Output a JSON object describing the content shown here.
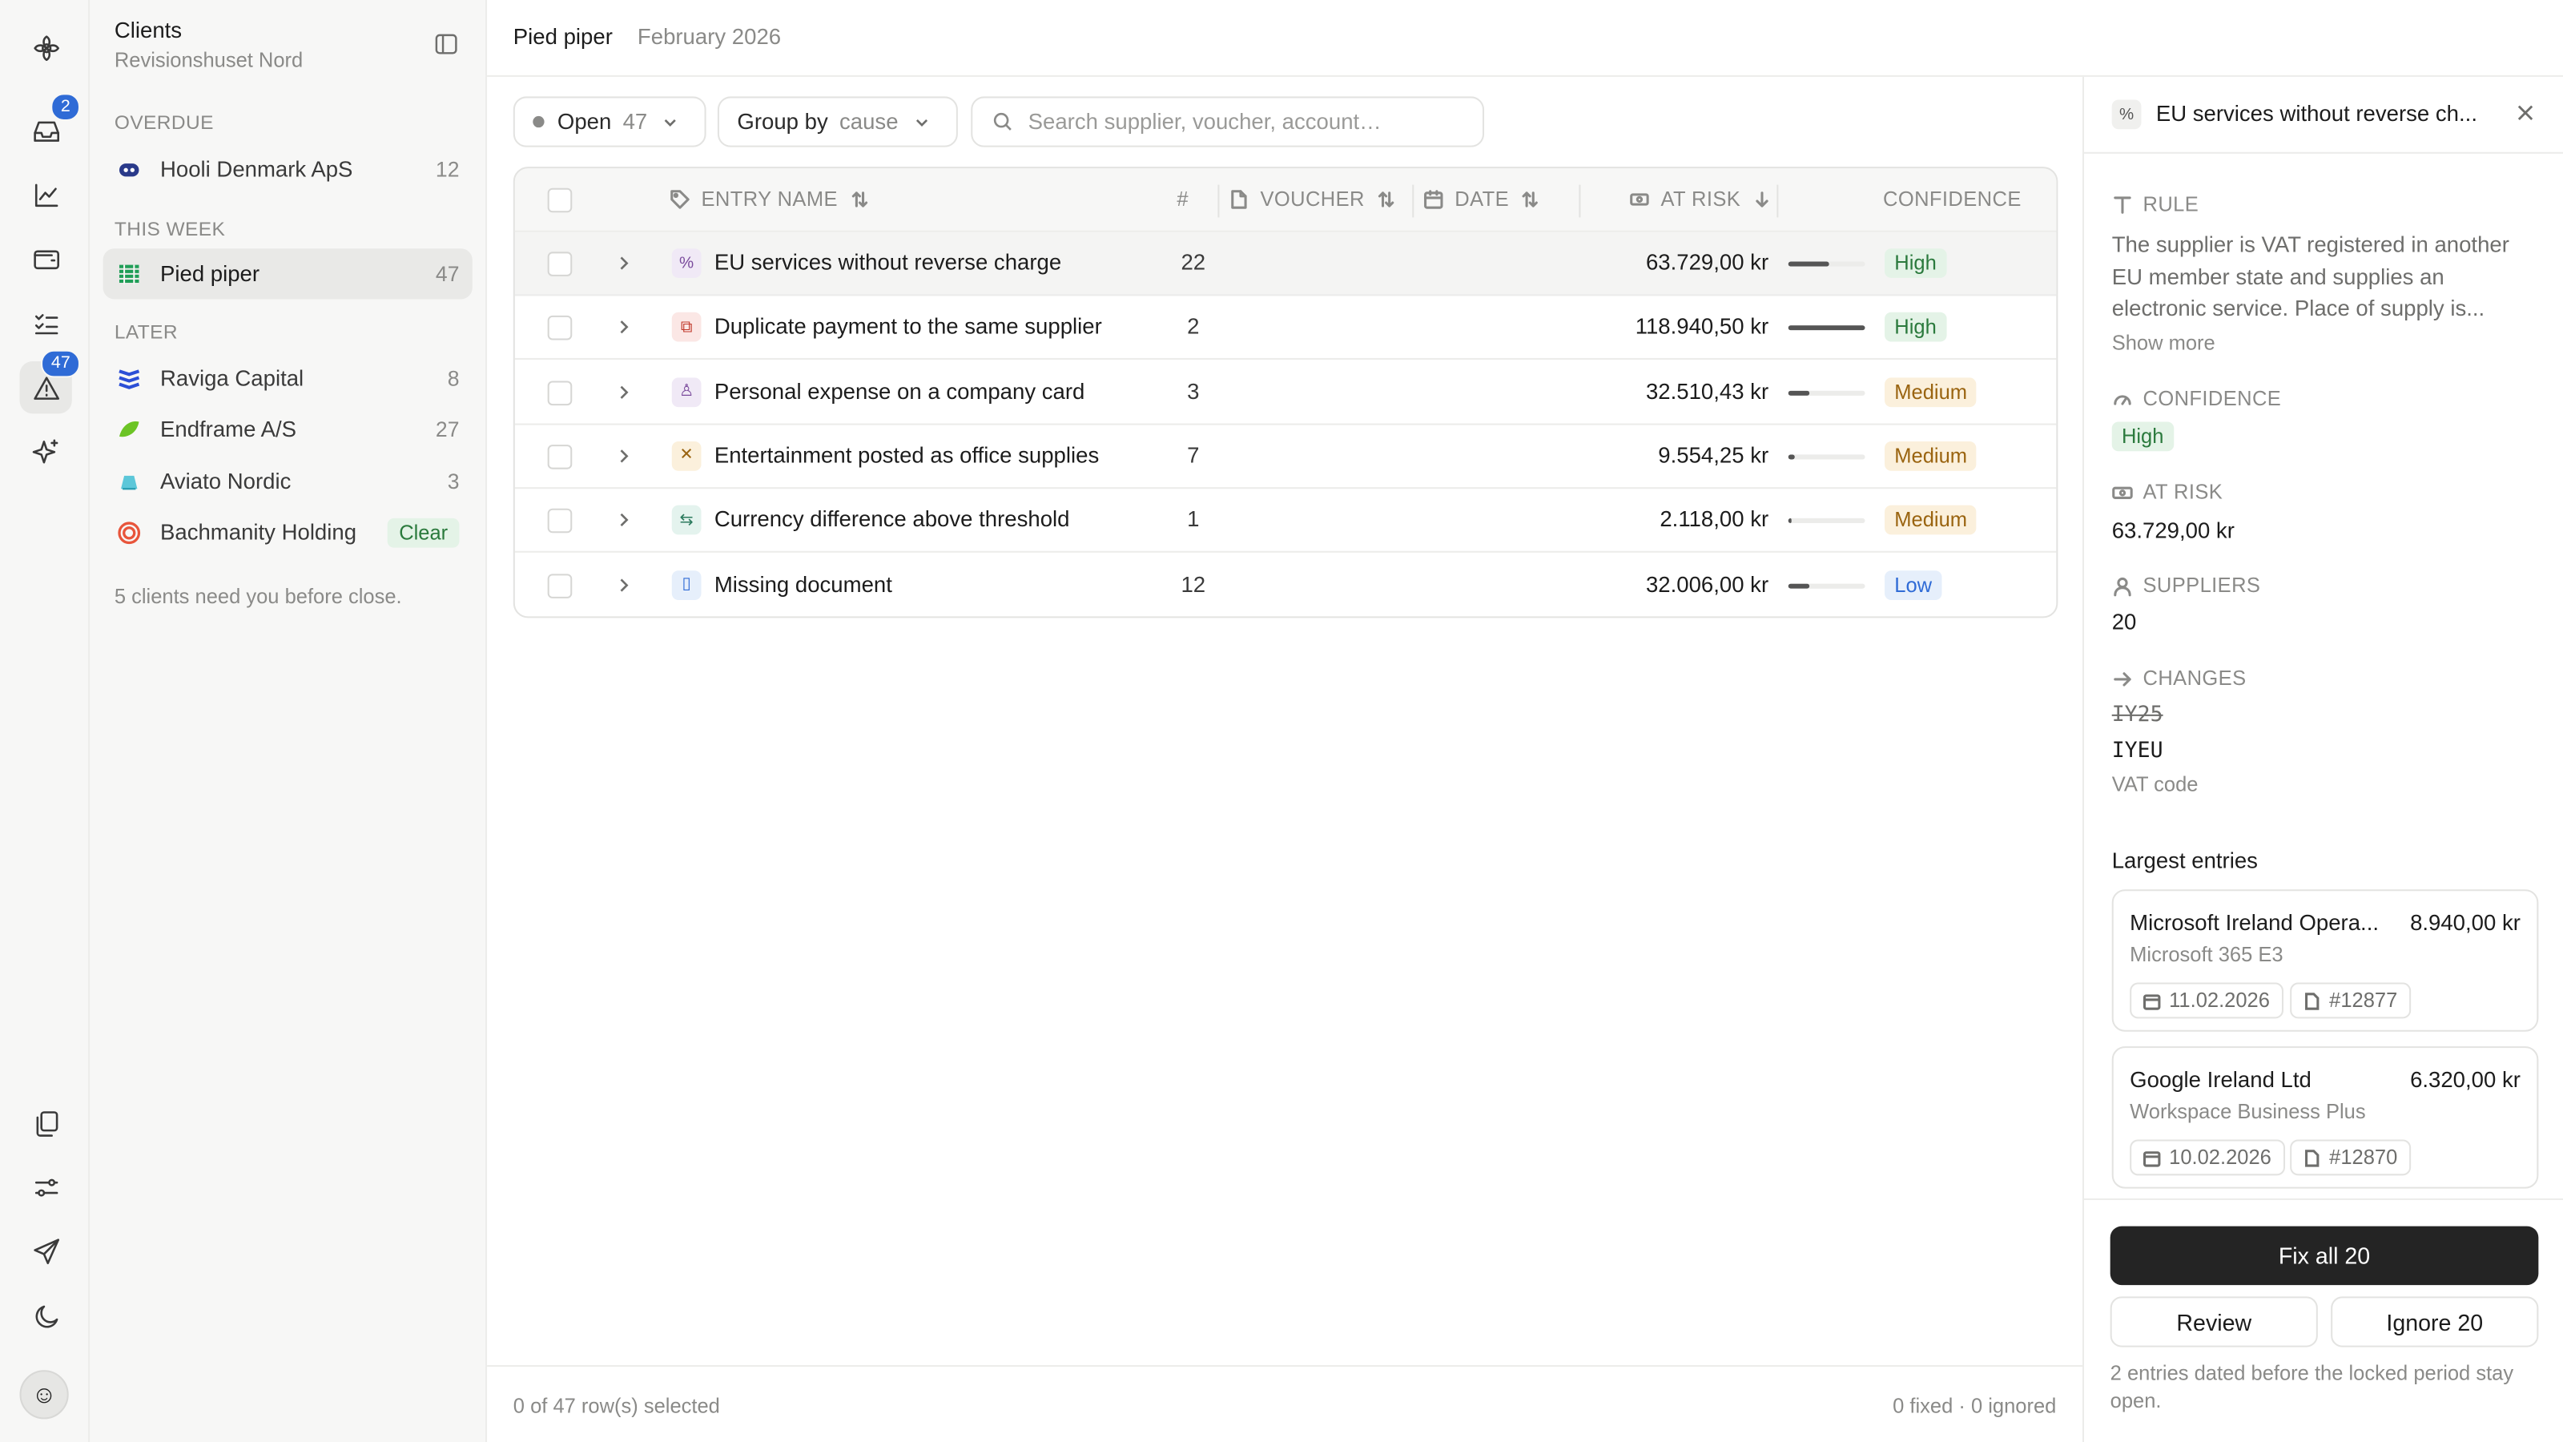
{
  "rail": {
    "inbox_badge": "2",
    "alerts_badge": "47"
  },
  "sidebar": {
    "title": "Clients",
    "subtitle": "Revisionshuset Nord",
    "sections": {
      "overdue": "OVERDUE",
      "this_week": "THIS WEEK",
      "later": "LATER"
    },
    "clients": [
      {
        "name": "Hooli Denmark ApS",
        "count": "12"
      },
      {
        "name": "Pied piper",
        "count": "47"
      },
      {
        "name": "Raviga Capital",
        "count": "8"
      },
      {
        "name": "Endframe A/S",
        "count": "27"
      },
      {
        "name": "Aviato Nordic",
        "count": "3"
      },
      {
        "name": "Bachmanity Holding",
        "status": "Clear"
      }
    ],
    "footer": "5 clients need you before close."
  },
  "header": {
    "client": "Pied piper",
    "period": "February 2026"
  },
  "toolbar": {
    "status_label": "Open",
    "status_count": "47",
    "group_label": "Group by",
    "group_value": "cause",
    "search_placeholder": "Search supplier, voucher, account…"
  },
  "table": {
    "columns": {
      "name": "ENTRY NAME",
      "count": "#",
      "voucher": "VOUCHER",
      "date": "DATE",
      "at_risk": "AT RISK",
      "confidence": "CONFIDENCE"
    },
    "rows": [
      {
        "name": "EU services without reverse charge",
        "count": "22",
        "amount": "63.729,00 kr",
        "risk": 0.54,
        "confidence": "High",
        "icon": "percent-icon"
      },
      {
        "name": "Duplicate payment to the same supplier",
        "count": "2",
        "amount": "118.940,50 kr",
        "risk": 1.0,
        "confidence": "High",
        "icon": "copy-icon"
      },
      {
        "name": "Personal expense on a company card",
        "count": "3",
        "amount": "32.510,43 kr",
        "risk": 0.27,
        "confidence": "Medium",
        "icon": "user-icon"
      },
      {
        "name": "Entertainment posted as office supplies",
        "count": "7",
        "amount": "9.554,25 kr",
        "risk": 0.08,
        "confidence": "Medium",
        "icon": "utensils-icon"
      },
      {
        "name": "Currency difference above threshold",
        "count": "1",
        "amount": "2.118,00 kr",
        "risk": 0.02,
        "confidence": "Medium",
        "icon": "exchange-icon"
      },
      {
        "name": "Missing document",
        "count": "12",
        "amount": "32.006,00 kr",
        "risk": 0.27,
        "confidence": "Low",
        "icon": "document-icon"
      }
    ],
    "footer_left": "0 of 47 row(s) selected",
    "footer_right": "0 fixed · 0 ignored"
  },
  "panel": {
    "title": "EU services without reverse ch...",
    "rule_label": "RULE",
    "rule_text": "The supplier is VAT registered in another EU member state and supplies an electronic service. Place of supply is...",
    "show_more": "Show more",
    "confidence_label": "CONFIDENCE",
    "confidence_value": "High",
    "at_risk_label": "AT RISK",
    "at_risk_value": "63.729,00 kr",
    "suppliers_label": "SUPPLIERS",
    "suppliers_value": "20",
    "changes_label": "CHANGES",
    "change_from": "IY25",
    "change_to": "IYEU",
    "change_caption": "VAT code",
    "largest_title": "Largest entries",
    "entries": [
      {
        "name": "Microsoft Ireland Opera...",
        "amount": "8.940,00 kr",
        "desc": "Microsoft 365 E3",
        "date": "11.02.2026",
        "voucher": "#12877"
      },
      {
        "name": "Google Ireland Ltd",
        "amount": "6.320,00 kr",
        "desc": "Workspace Business Plus",
        "date": "10.02.2026",
        "voucher": "#12870"
      }
    ],
    "fix_label": "Fix all 20",
    "review_label": "Review",
    "ignore_label": "Ignore 20",
    "note": "2 entries dated before the locked period stay open."
  },
  "colors": {
    "accent": "#2f6bd6",
    "high": "#2b7a3d",
    "medium": "#9a6410",
    "low": "#2f6bd6",
    "primary_button": "#242424"
  }
}
